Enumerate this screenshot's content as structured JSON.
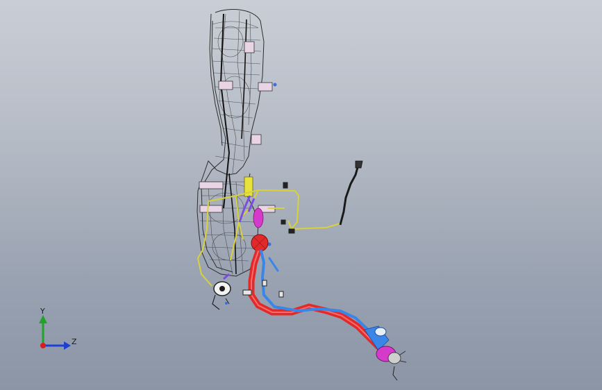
{
  "view": {
    "background_top": "#c9ced6",
    "background_bottom": "#8b95a6"
  },
  "triad": {
    "y_label": "Y",
    "z_label": "Z",
    "x_color": "#d61e1e",
    "y_color": "#1fa32a",
    "z_color": "#1d3fd6"
  },
  "model": {
    "tank_wire_color": "#2b2b2b",
    "harness_color": "#e6e04a",
    "filler_pipe_color": "#e22a2a",
    "vent_pipe_color": "#3a86e8",
    "seal_color": "#d63acb",
    "connector_color": "#7a4fe0",
    "hose_color": "#1a1a1a"
  }
}
